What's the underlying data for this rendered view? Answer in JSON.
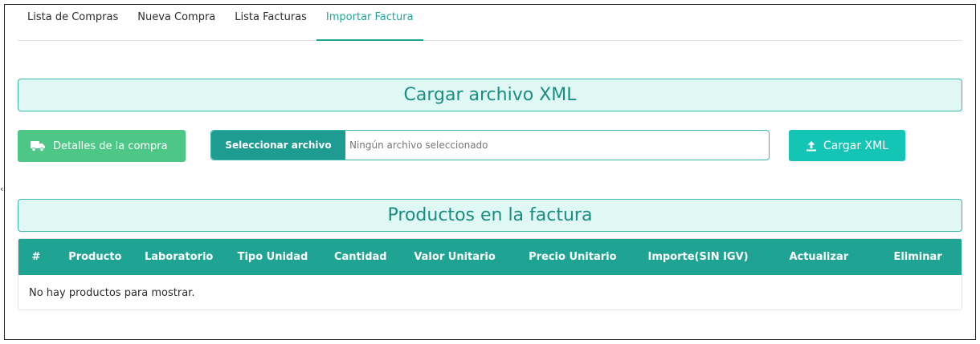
{
  "tabs": [
    {
      "label": "Lista de Compras",
      "active": false
    },
    {
      "label": "Nueva Compra",
      "active": false
    },
    {
      "label": "Lista Facturas",
      "active": false
    },
    {
      "label": "Importar Factura",
      "active": true
    }
  ],
  "upload_section": {
    "title": "Cargar archivo XML",
    "details_button": {
      "label": "Detalles de la compra",
      "icon": "truck-icon"
    },
    "file_input": {
      "button_label": "Seleccionar archivo",
      "status_text": "Ningún archivo seleccionado"
    },
    "upload_button": {
      "label": "Cargar XML",
      "icon": "upload-icon"
    }
  },
  "side_mark": "‹",
  "products_section": {
    "title": "Productos en la factura",
    "columns": [
      "#",
      "Producto",
      "Laboratorio",
      "Tipo Unidad",
      "Cantidad",
      "Valor Unitario",
      "Precio Unitario",
      "Importe(SIN IGV)",
      "Actualizar",
      "Eliminar"
    ],
    "empty_message": "No hay productos para mostrar."
  },
  "colors": {
    "accent": "#25a39a",
    "header_bg": "#dff8f3",
    "details_button": "#4cc785",
    "upload_button": "#14c4b4",
    "table_header": "#1fa494"
  }
}
